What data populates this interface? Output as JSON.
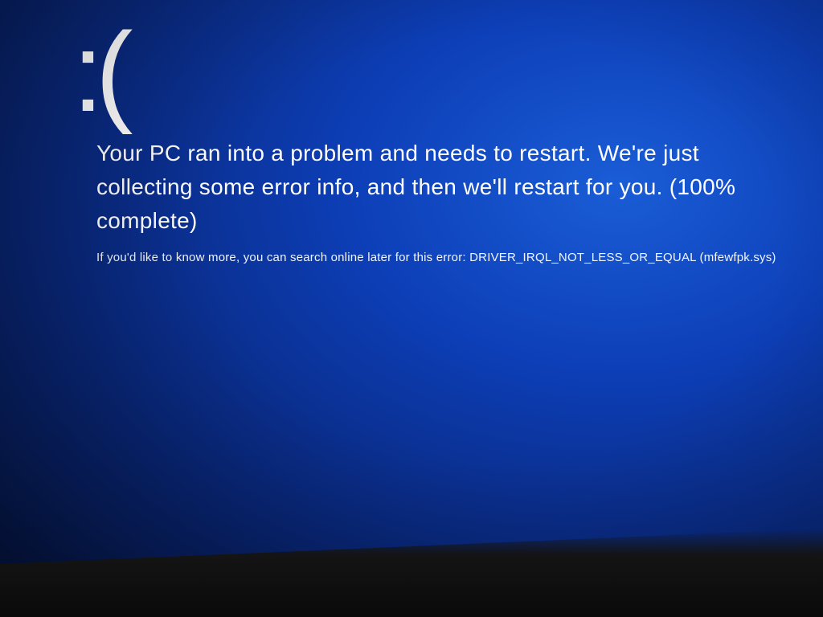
{
  "bsod": {
    "emoticon": ":(",
    "primary_message": "Your PC ran into a problem and needs to restart. We're just collecting some error info, and then we'll restart for you. (100% complete)",
    "secondary_message": "If you'd like to know more, you can search online later for this error: DRIVER_IRQL_NOT_LESS_OR_EQUAL (mfewfpk.sys)",
    "progress_percent": 100,
    "error_code": "DRIVER_IRQL_NOT_LESS_OR_EQUAL",
    "fault_module": "mfewfpk.sys"
  }
}
